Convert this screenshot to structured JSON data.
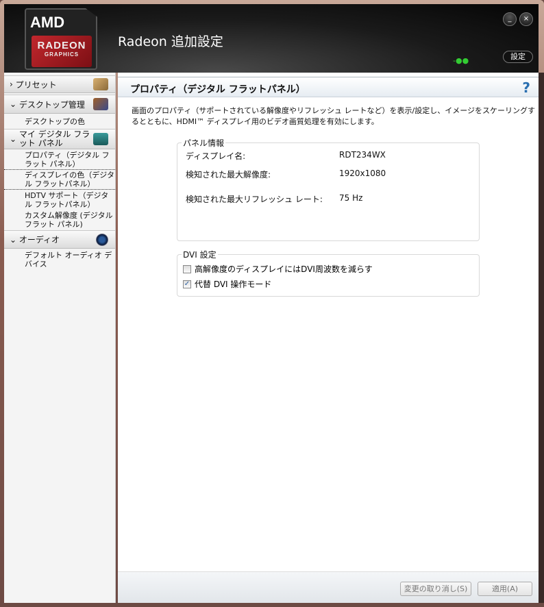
{
  "window": {
    "title": "Radeon 追加設定",
    "settings_label": "設定",
    "minimize_label": "_",
    "close_label": "×"
  },
  "logo": {
    "amd": "AMD",
    "radeon": "RADEON",
    "graphics": "GRAPHICS"
  },
  "sidebar": {
    "sections": [
      {
        "label": "プリセット",
        "chevron": "›",
        "items": []
      },
      {
        "label": "デスクトップ管理",
        "chevron": "⌄",
        "items": [
          "デスクトップの色"
        ]
      },
      {
        "label": "マイ デジタル フラット パネル",
        "chevron": "⌄",
        "items": [
          "プロパティ（デジタル フラット パネル）",
          "ディスプレイの色（デジタル フラットパネル）",
          "HDTV サポート（デジタル フラットパネル）",
          "カスタム解像度 (デジタル フラット パネル)"
        ]
      },
      {
        "label": "オーディオ",
        "chevron": "⌄",
        "items": [
          "デフォルト オーディオ デバイス"
        ]
      }
    ]
  },
  "main": {
    "title": "プロパティ（デジタル フラットパネル）",
    "help": "?",
    "description": "画面のプロパティ（サポートされている解像度やリフレッシュ レートなど）を表示/設定し、イメージをスケーリングするとともに、HDMI™ ディスプレイ用のビデオ画質処理を有効にします。",
    "panel_info": {
      "legend": "パネル情報",
      "rows": [
        {
          "label": "ディスプレイ名:",
          "value": "RDT234WX"
        },
        {
          "label": "検知された最大解像度:",
          "value": "1920x1080"
        },
        {
          "label": "検知された最大リフレッシュ レート:",
          "value": "75 Hz"
        }
      ]
    },
    "dvi": {
      "legend": "DVI 設定",
      "options": [
        {
          "label": "高解像度のディスプレイにはDVI周波数を減らす",
          "checked": false,
          "mark": ""
        },
        {
          "label": "代替 DVI 操作モード",
          "checked": true,
          "mark": "✓"
        }
      ]
    },
    "buttons": {
      "discard": "変更の取り消し(S)",
      "apply": "適用(A)"
    }
  }
}
